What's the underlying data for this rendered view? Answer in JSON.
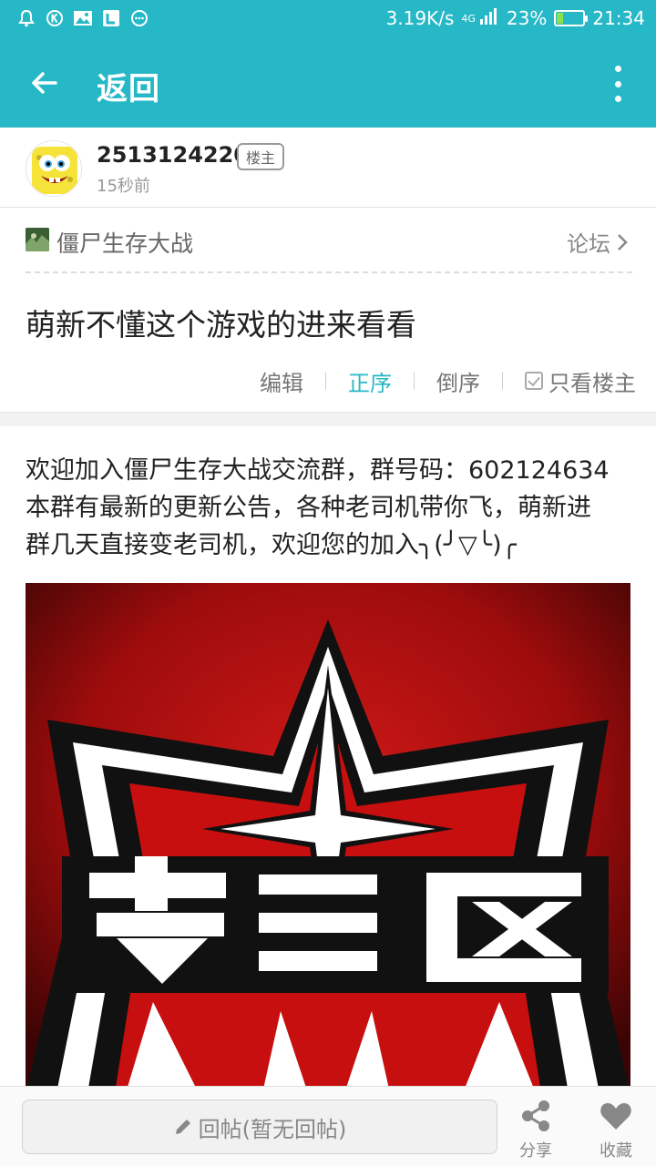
{
  "status_bar": {
    "net_speed": "3.19K/s",
    "network_type": "4G",
    "battery_percent": "23%",
    "battery_level": 0.23,
    "time": "21:34",
    "left_icons": [
      "bell-icon",
      "k-app-icon",
      "image-icon",
      "l-app-icon",
      "chat-bubble-icon"
    ]
  },
  "app_bar": {
    "title": "返回"
  },
  "author": {
    "username": "2513124220",
    "badge": "楼主",
    "time": "15秒前"
  },
  "forum": {
    "name": "僵尸生存大战",
    "link": "论坛"
  },
  "post": {
    "title": "萌新不懂这个游戏的进来看看",
    "order_options": {
      "edit": "编辑",
      "asc": "正序",
      "desc": "倒序",
      "op_only": "只看楼主"
    },
    "body_lines": [
      "欢迎加入僵尸生存大战交流群，群号码：602124634",
      "本群有最新的更新公告，各种老司机带你飞，萌新进",
      "群几天直接变老司机，欢迎您的加入╮(╯▽╰)╭"
    ],
    "image_text": "安全区"
  },
  "bottom_bar": {
    "reply_placeholder": "回帖(暂无回帖)",
    "share_label": "分享",
    "favorite_label": "收藏"
  },
  "colors": {
    "accent": "#26b8c6",
    "image_red": "#c80f0f"
  }
}
